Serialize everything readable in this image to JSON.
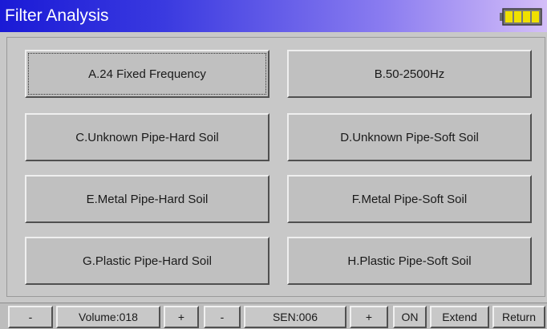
{
  "window": {
    "title": "Filter Analysis",
    "battery_icon": "battery-icon"
  },
  "menu": {
    "items": [
      {
        "label": "A.24 Fixed Frequency",
        "selected": true
      },
      {
        "label": "B.50-2500Hz"
      },
      {
        "label": "C.Unknown Pipe-Hard Soil"
      },
      {
        "label": "D.Unknown Pipe-Soft Soil"
      },
      {
        "label": "E.Metal Pipe-Hard Soil"
      },
      {
        "label": "F.Metal Pipe-Soft Soil"
      },
      {
        "label": "G.Plastic Pipe-Hard Soil"
      },
      {
        "label": "H.Plastic Pipe-Soft Soil"
      }
    ]
  },
  "toolbar": {
    "volume_minus": "-",
    "volume": "Volume:018",
    "volume_plus": "+",
    "sen_minus": "-",
    "sen": "SEN:006",
    "sen_plus": "+",
    "on": "ON",
    "extend": "Extend",
    "return": "Return"
  },
  "colors": {
    "title_gradient_start": "#1a1ad6",
    "title_gradient_end": "#d4bef8",
    "background": "#c8c8c8",
    "battery_fill": "#f0e000"
  }
}
